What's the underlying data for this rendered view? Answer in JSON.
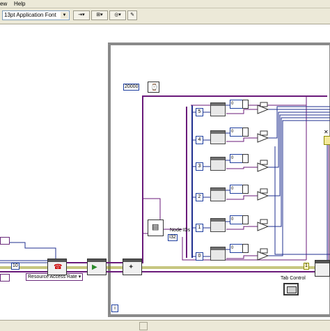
{
  "menubar": {
    "items": [
      "ew",
      "Help"
    ]
  },
  "toolbar": {
    "font_ring": "13pt Application Font"
  },
  "diagram": {
    "const_20000": "20000",
    "const_10": "10",
    "const_1": "1",
    "node_ids_label": "Node IDs",
    "node_ids_type": "I32",
    "resource_access_rate": "Resource Access Rate",
    "tab_control_label": "Tab Control",
    "loop_iteration": "i",
    "index_values": [
      "5",
      "4",
      "3",
      "2",
      "1",
      "0"
    ],
    "chip_values": [
      "0",
      "0",
      "0",
      "0",
      "0",
      "0"
    ]
  },
  "colors": {
    "purple_wire": "#6a1a7a",
    "blue_wire": "#1f2f8f",
    "olive_wire": "#8c8c00",
    "loop_border": "#8a8a8a"
  }
}
